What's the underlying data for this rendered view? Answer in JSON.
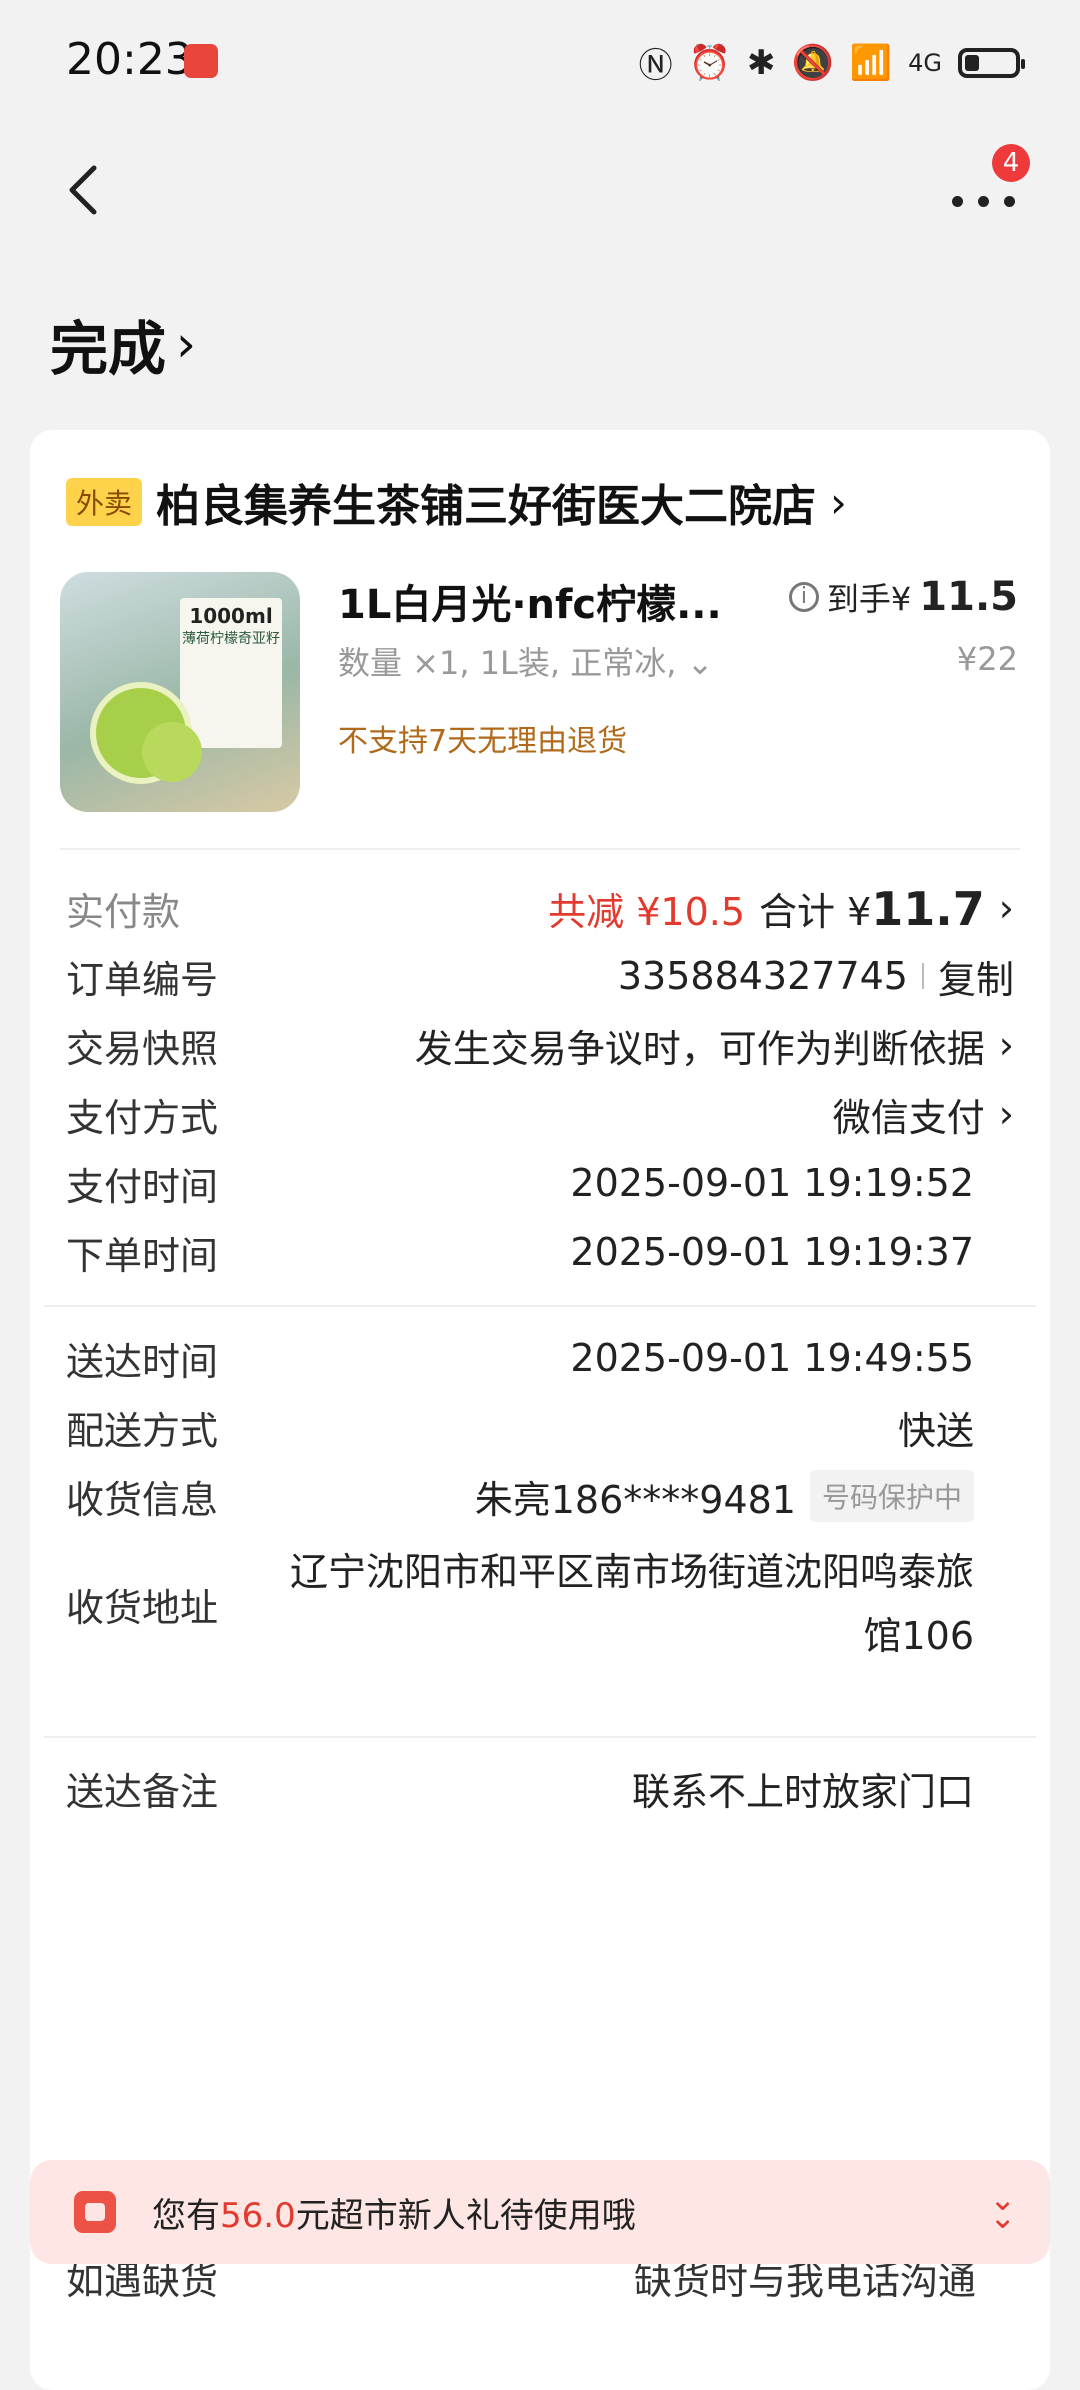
{
  "status_bar": {
    "time": "20:23",
    "network": "4G"
  },
  "nav": {
    "badge_count": "4"
  },
  "order_status": {
    "title": "完成"
  },
  "store": {
    "tag": "外卖",
    "name": "柏良集养生茶铺三好街医大二院店"
  },
  "product": {
    "image_label_title": "1000ml",
    "image_label_sub": "薄荷柠檬奇亚籽",
    "name": "1L白月光·nfc柠檬...",
    "price_prefix": "到手¥",
    "price_amount": "11.5",
    "spec": "数量 ×1, 1L装, 正常冰,",
    "original_price": "¥22",
    "note": "不支持7天无理由退货"
  },
  "payment": {
    "label": "实付款",
    "discount": "共减 ¥10.5",
    "total_prefix": "合计 ¥",
    "total_amount": "11.7"
  },
  "details": {
    "order_no_label": "订单编号",
    "order_no": "335884327745",
    "copy_label": "复制",
    "snapshot_label": "交易快照",
    "snapshot_value": "发生交易争议时，可作为判断依据",
    "pay_method_label": "支付方式",
    "pay_method": "微信支付",
    "pay_time_label": "支付时间",
    "pay_time": "2025-09-01 19:19:52",
    "order_time_label": "下单时间",
    "order_time": "2025-09-01 19:19:37",
    "delivery_time_label": "送达时间",
    "delivery_time": "2025-09-01 19:49:55",
    "delivery_method_label": "配送方式",
    "delivery_method": "快送",
    "receiver_label": "收货信息",
    "receiver": "朱亮186****9481",
    "privacy_pill": "号码保护中",
    "address_label": "收货地址",
    "address": "辽宁沈阳市和平区南市场街道沈阳鸣泰旅馆106",
    "remark_label": "送达备注",
    "remark": "联系不上时放家门口",
    "stockout_label": "如遇缺货",
    "stockout": "缺货时与我电话沟通"
  },
  "promo": {
    "prefix": "您有",
    "amount": "56.0",
    "suffix": "元超市新人礼待使用哦"
  },
  "colors": {
    "accent_red": "#e23a2e",
    "tag_yellow": "#ffd24c",
    "promo_bg": "#fde6e4"
  }
}
